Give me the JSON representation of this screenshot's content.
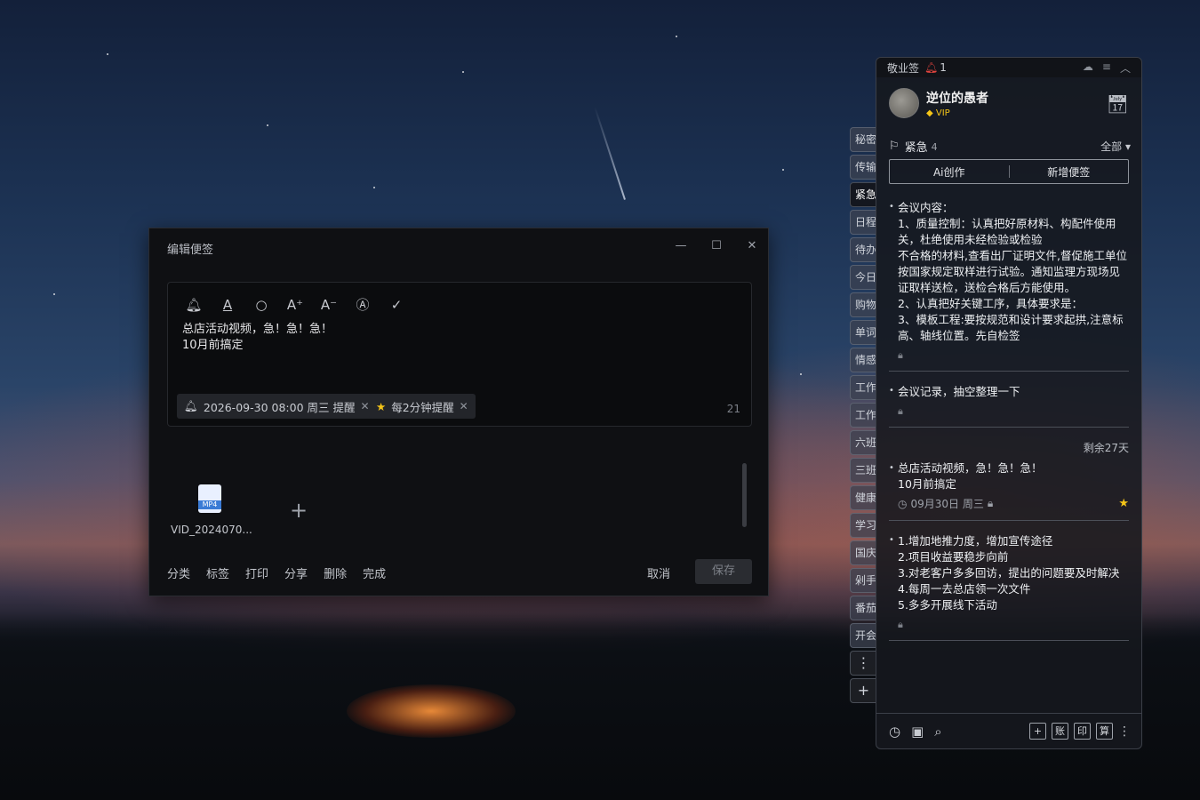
{
  "dialog": {
    "title": "编辑便签",
    "minimize_glyph": "—",
    "maximize_glyph": "☐",
    "close_glyph": "✕",
    "toolbar_icons": [
      "bell-icon",
      "font-color-icon",
      "search-icon",
      "font-increase-icon",
      "font-decrease-icon",
      "text-style-icon",
      "check-icon"
    ],
    "content_line1": "总店活动视频，急！急！急！",
    "content_line2": "10月前搞定",
    "reminder_chip": "2026-09-30 08:00 周三 提醒",
    "repeat_chip": "每2分钟提醒",
    "char_count": "21",
    "attachment_type": "MP4",
    "attachment_name": "VID_2024070...",
    "footer": {
      "category": "分类",
      "tag": "标签",
      "print": "打印",
      "share": "分享",
      "delete": "删除",
      "done": "完成"
    },
    "cancel": "取消",
    "save": "保存"
  },
  "side_tabs": [
    "秘密",
    "传输",
    "紧急",
    "日程",
    "待办",
    "今日",
    "购物",
    "单词",
    "情感",
    "工作",
    "工作",
    "六班",
    "三班",
    "健康",
    "学习",
    "国庆",
    "剁手",
    "番茄",
    "开会"
  ],
  "side_tools": {
    "more": "⋮",
    "add": "+"
  },
  "panel": {
    "app_name": "敬业签",
    "reminder_count": "1",
    "user_name": "逆位的愚者",
    "vip_label": "VIP",
    "category": "紧急",
    "category_count": "4",
    "filter": "全部",
    "ai_create": "Ai创作",
    "new_note": "新增便签",
    "notes": [
      {
        "text": "会议内容：\n1、质量控制：认真把好原材料、构配件使用关，杜绝使用未经检验或检验\n不合格的材料,查看出厂证明文件,督促施工单位按国家规定取样进行试验。通知监理方现场见证取样送检，送检合格后方能使用。\n2、认真把好关键工序，具体要求是：\n3、模板工程:要按规范和设计要求起拱,注意标高、轴线位置。先自检签"
      },
      {
        "text": "会议记录，抽空整理一下"
      },
      {
        "remaining": "剩余27天",
        "text": "总店活动视频，急！急！急！\n10月前搞定",
        "date": "09月30日 周三"
      },
      {
        "text": "1.增加地推力度，增加宣传途径\n2.项目收益要稳步向前\n3.对老客户多多回访，提出的问题要及时解决\n4.每周一去总店领一次文件\n5.多多开展线下活动"
      }
    ],
    "bottom_buttons": [
      "账",
      "印",
      "算"
    ]
  }
}
